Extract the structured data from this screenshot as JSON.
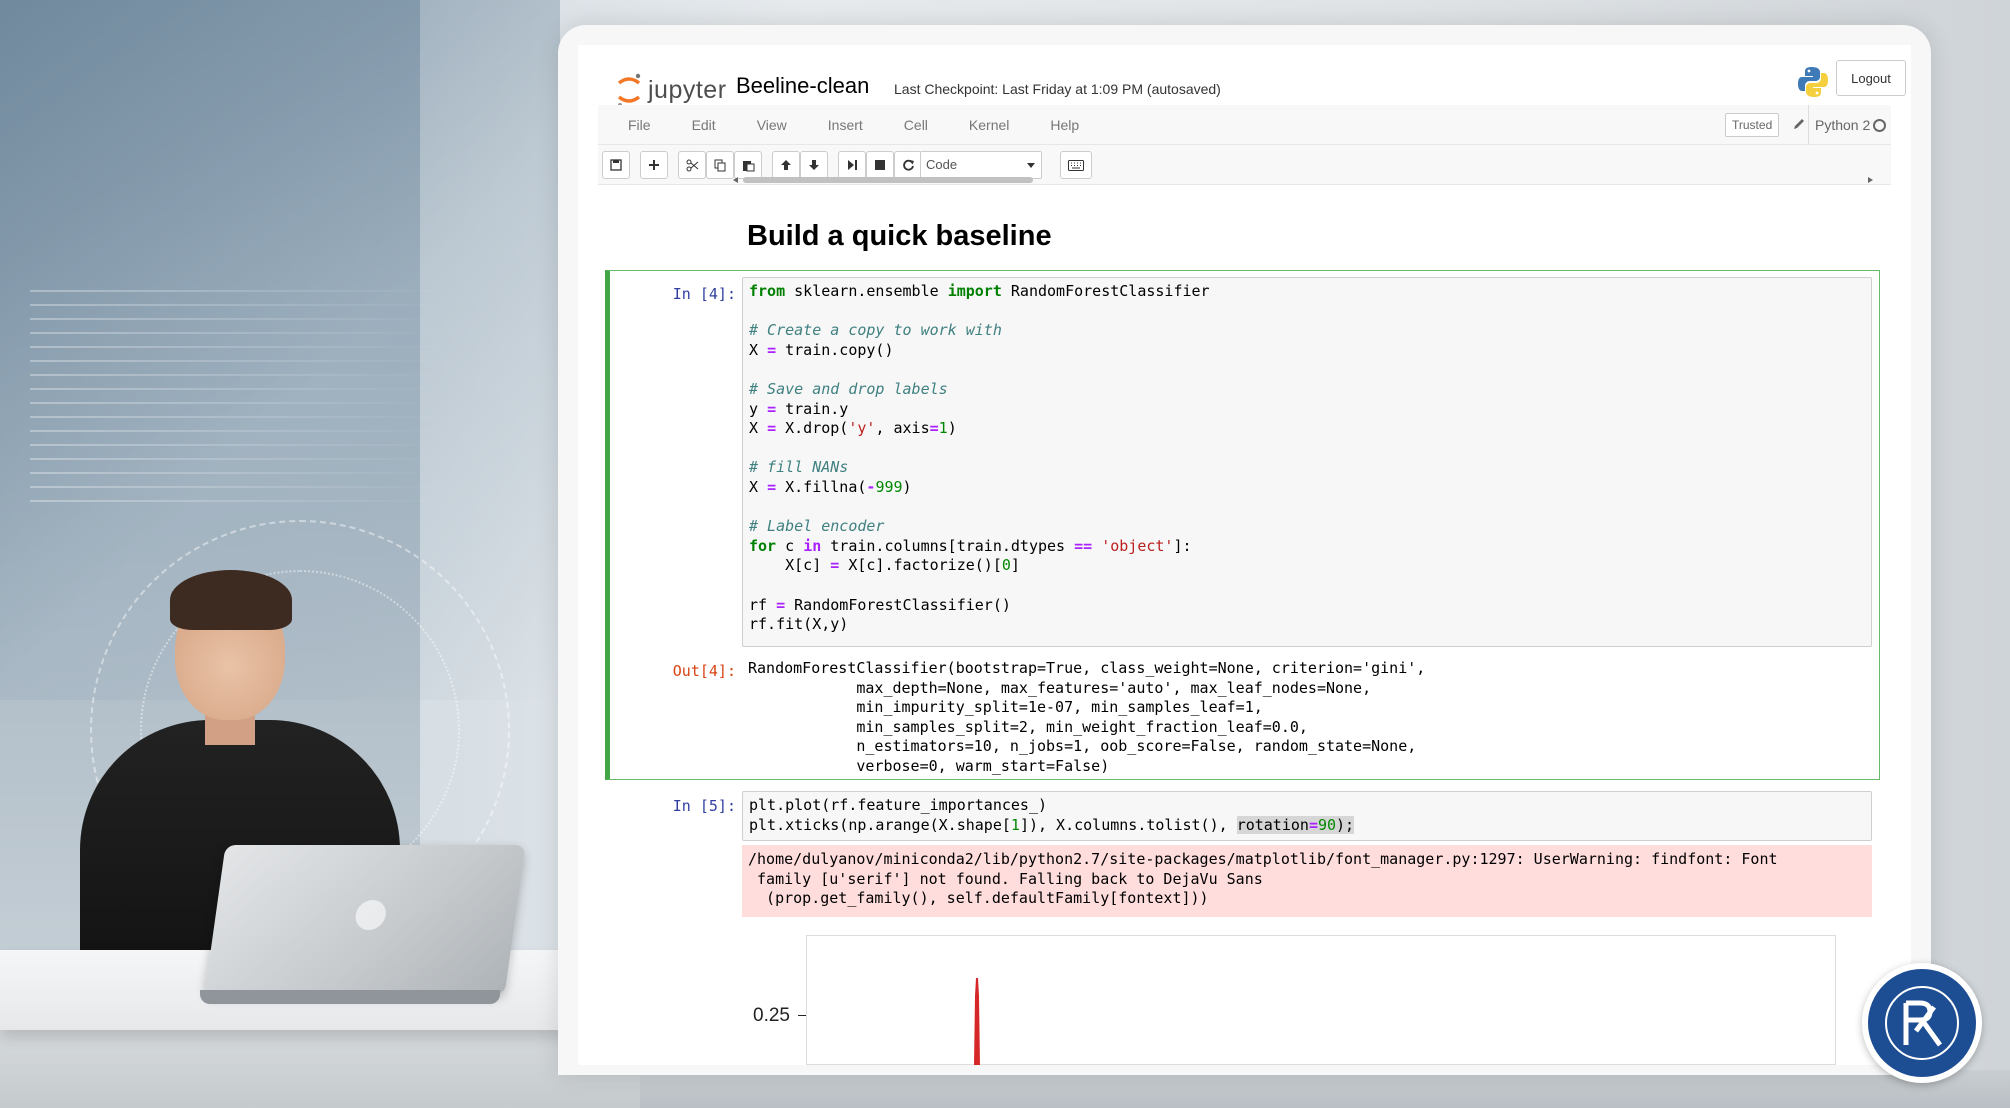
{
  "app": {
    "logo_text": "jupyter",
    "notebook_name": "Beeline-clean",
    "checkpoint": "Last Checkpoint: Last Friday at 1:09 PM (autosaved)",
    "logout_label": "Logout"
  },
  "menubar": {
    "items": [
      {
        "label": "File"
      },
      {
        "label": "Edit"
      },
      {
        "label": "View"
      },
      {
        "label": "Insert"
      },
      {
        "label": "Cell"
      },
      {
        "label": "Kernel"
      },
      {
        "label": "Help"
      }
    ],
    "trusted_label": "Trusted",
    "kernel_name": "Python 2"
  },
  "toolbar": {
    "cell_type": "Code",
    "buttons": [
      "save-icon",
      "plus-icon",
      "cut-icon",
      "copy-icon",
      "paste-icon",
      "arrow-up-icon",
      "arrow-down-icon",
      "step-forward-icon",
      "stop-icon",
      "restart-icon",
      "keyboard-icon"
    ]
  },
  "notebook": {
    "heading": "Build a quick baseline",
    "cell4": {
      "in_prompt": "In [4]:",
      "out_prompt": "Out[4]:",
      "output": "RandomForestClassifier(bootstrap=True, class_weight=None, criterion='gini',\n            max_depth=None, max_features='auto', max_leaf_nodes=None,\n            min_impurity_split=1e-07, min_samples_leaf=1,\n            min_samples_split=2, min_weight_fraction_leaf=0.0,\n            n_estimators=10, n_jobs=1, oob_score=False, random_state=None,\n            verbose=0, warm_start=False)"
    },
    "cell5": {
      "in_prompt": "In [5]:",
      "stderr": "/home/dulyanov/miniconda2/lib/python2.7/site-packages/matplotlib/font_manager.py:1297: UserWarning: findfont: Font\n family [u'serif'] not found. Falling back to DejaVu Sans\n  (prop.get_family(), self.defaultFamily[fontext]))",
      "plot_tick": "0.25"
    }
  },
  "colors": {
    "selected_border": "#42a547",
    "in_prompt": "#303f9f",
    "out_prompt": "#d84315",
    "stderr_bg": "#ffdddd",
    "plot_line": "#d62728"
  }
}
